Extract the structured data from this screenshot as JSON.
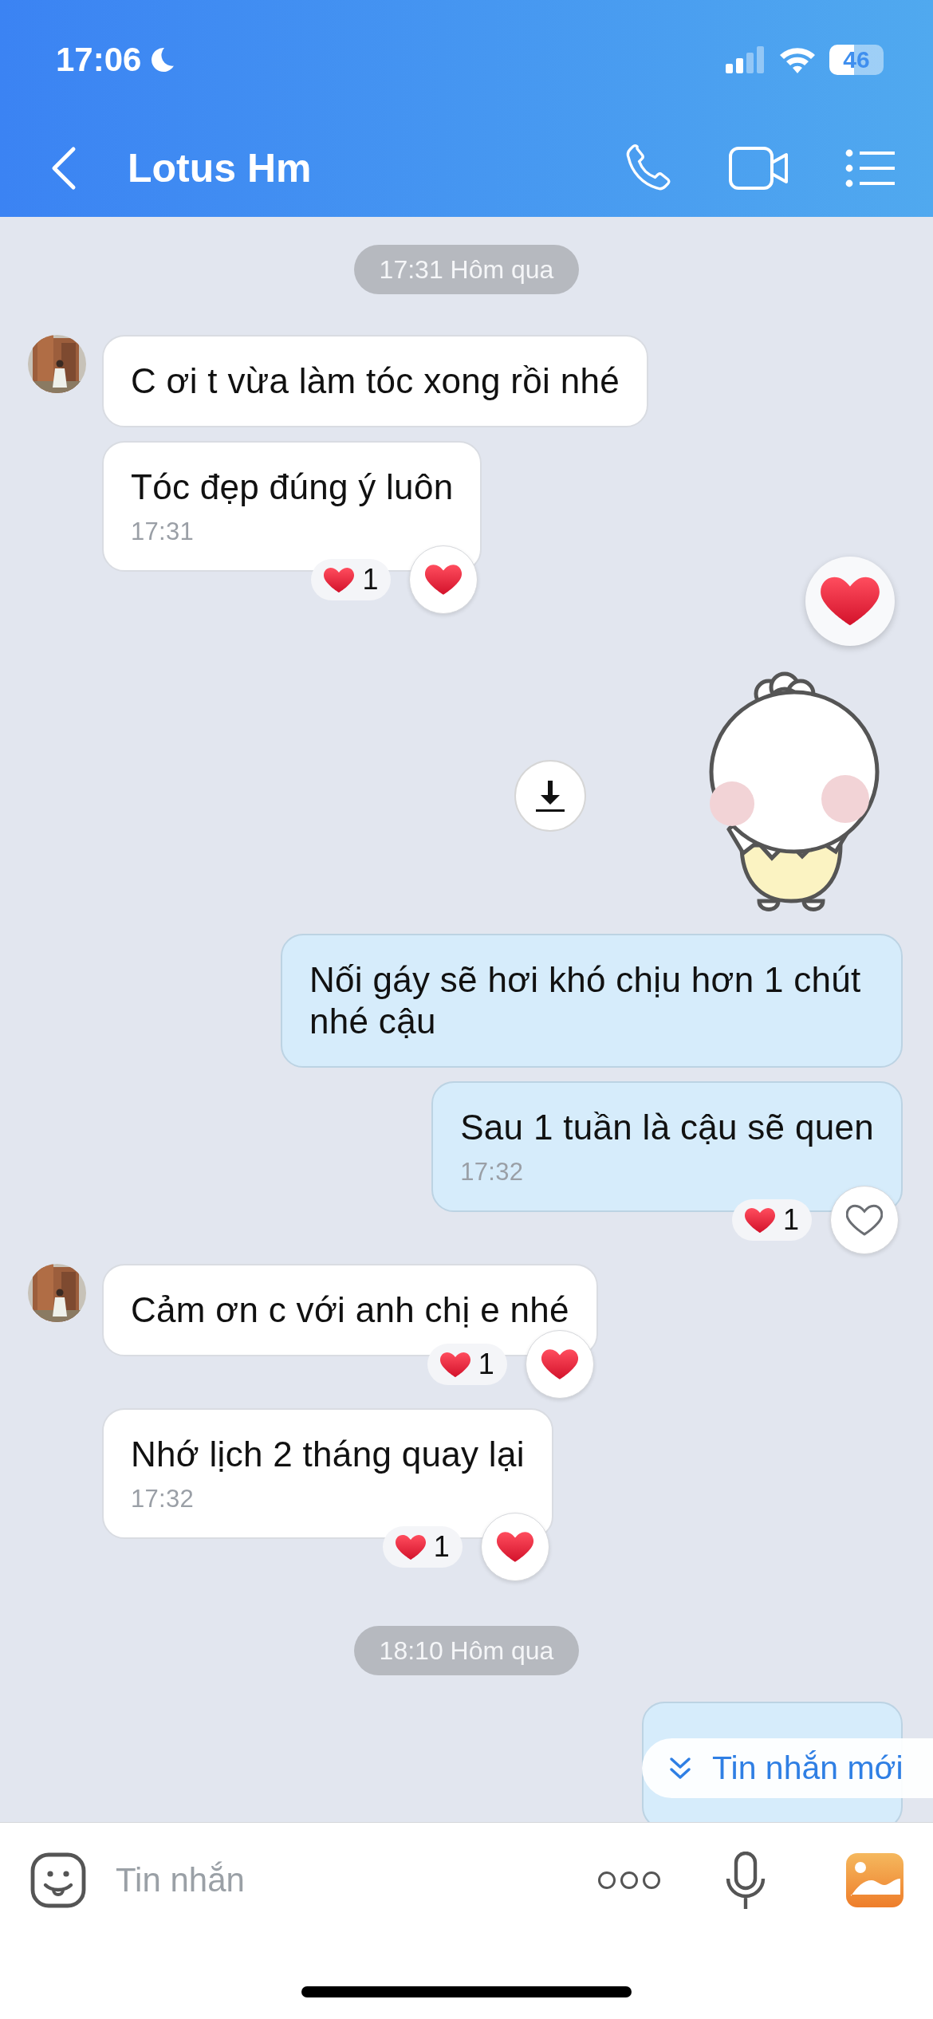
{
  "status_bar": {
    "time": "17:06",
    "battery": "46"
  },
  "header": {
    "title": "Lotus Hm"
  },
  "messages": [
    {
      "kind": "date",
      "text": "17:31 Hôm qua"
    },
    {
      "kind": "text",
      "outgoing": false,
      "avatar": true,
      "text": "C ơi t vừa làm tóc xong rồi nhé"
    },
    {
      "kind": "text",
      "outgoing": false,
      "avatar": false,
      "text": "Tóc đẹp đúng ý luôn",
      "time": "17:31",
      "reaction_count": "1",
      "liked": true
    },
    {
      "kind": "quick_reaction"
    },
    {
      "kind": "sticker",
      "outgoing": true
    },
    {
      "kind": "text",
      "outgoing": true,
      "text": "Nối gáy sẽ hơi khó chịu hơn 1 chút nhé cậu"
    },
    {
      "kind": "text",
      "outgoing": true,
      "text": "Sau 1 tuần là cậu sẽ quen",
      "time": "17:32",
      "reaction_count": "1",
      "liked": false
    },
    {
      "kind": "text",
      "outgoing": false,
      "avatar": true,
      "text": "Cảm ơn c với anh chị e nhé",
      "reaction_count": "1",
      "liked": true
    },
    {
      "kind": "text",
      "outgoing": false,
      "avatar": false,
      "text": "Nhớ lịch 2 tháng quay lại",
      "time": "17:32",
      "reaction_count": "1",
      "liked": true
    },
    {
      "kind": "date",
      "text": "18:10 Hôm qua"
    },
    {
      "kind": "partial",
      "outgoing": true
    }
  ],
  "new_messages_banner": {
    "label": "Tin nhắn mới"
  },
  "composer": {
    "placeholder": "Tin nhắn"
  }
}
